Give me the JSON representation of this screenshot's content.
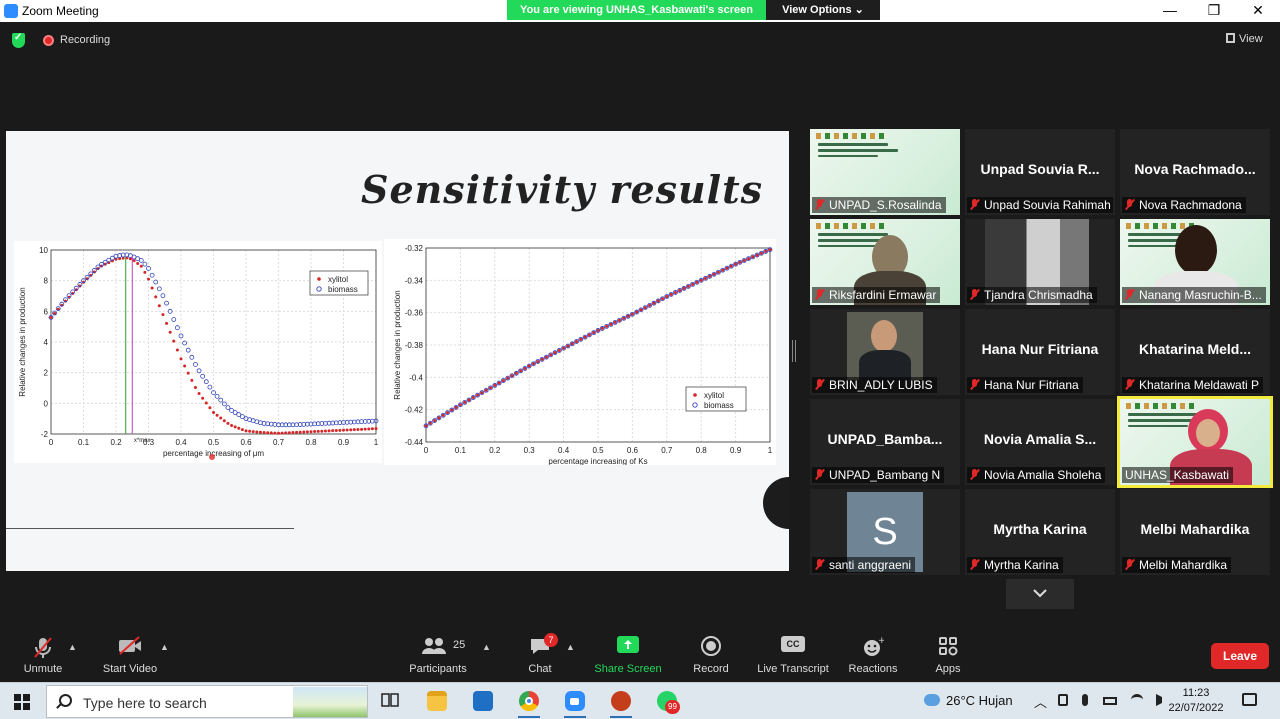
{
  "window": {
    "title": "Zoom Meeting",
    "banner": "You are viewing UNHAS_Kasbawati's screen",
    "view_options": "View Options",
    "minimize": "—",
    "maximize": "❐",
    "close": "✕"
  },
  "topbar": {
    "recording": "Recording",
    "view": "View"
  },
  "slide": {
    "title": "Sensitivity results",
    "left_chart": {
      "ylabel": "Relative changes in production",
      "xlabel": "percentage increasing of μm",
      "xticks": [
        "0",
        "0.1",
        "0.2",
        "0.3",
        "0.4",
        "0.5",
        "0.6",
        "0.7",
        "0.8",
        "0.9",
        "1"
      ],
      "yticks": [
        "10",
        "8",
        "6",
        "4",
        "2",
        "0",
        "-2"
      ],
      "legend": [
        "xylitol",
        "biomass"
      ],
      "max_label": "x*max"
    },
    "right_chart": {
      "ylabel": "Relative changes in production",
      "xlabel": "percentage increasing of Ks",
      "xticks": [
        "0",
        "0.1",
        "0.2",
        "0.3",
        "0.4",
        "0.5",
        "0.6",
        "0.7",
        "0.8",
        "0.9",
        "1"
      ],
      "yticks": [
        "-0.32",
        "-0.34",
        "-0.36",
        "-0.38",
        "-0.4",
        "-0.42",
        "-0.44"
      ],
      "legend": [
        "xylitol",
        "biomass"
      ]
    }
  },
  "chart_data": [
    {
      "type": "scatter",
      "xlabel": "percentage increasing of μm",
      "ylabel": "Relative changes in production",
      "xlim": [
        0,
        1
      ],
      "ylim": [
        -2,
        10
      ],
      "grid": true,
      "legend_position": "top-right",
      "series": [
        {
          "name": "xylitol",
          "color": "#d62728",
          "marker": "dot",
          "x": [
            0,
            0.05,
            0.1,
            0.15,
            0.2,
            0.23,
            0.25,
            0.28,
            0.3,
            0.35,
            0.4,
            0.45,
            0.5,
            0.55,
            0.6,
            0.65,
            0.7,
            0.75,
            0.8,
            0.85,
            0.9,
            0.95,
            1
          ],
          "y": [
            5.6,
            6.8,
            7.9,
            8.9,
            9.4,
            9.5,
            9.4,
            8.9,
            8.1,
            5.5,
            2.9,
            0.8,
            -0.6,
            -1.4,
            -1.8,
            -1.9,
            -1.95,
            -1.9,
            -1.85,
            -1.8,
            -1.75,
            -1.7,
            -1.65
          ]
        },
        {
          "name": "biomass",
          "color": "#3344bb",
          "marker": "circle",
          "x": [
            0,
            0.05,
            0.1,
            0.15,
            0.2,
            0.23,
            0.25,
            0.28,
            0.3,
            0.35,
            0.4,
            0.45,
            0.5,
            0.55,
            0.6,
            0.65,
            0.7,
            0.75,
            0.8,
            0.85,
            0.9,
            0.95,
            1
          ],
          "y": [
            5.6,
            6.9,
            8.0,
            9.0,
            9.6,
            9.7,
            9.6,
            9.3,
            8.8,
            6.8,
            4.4,
            2.3,
            0.7,
            -0.4,
            -1.0,
            -1.3,
            -1.4,
            -1.4,
            -1.35,
            -1.3,
            -1.25,
            -1.2,
            -1.15
          ]
        }
      ]
    },
    {
      "type": "scatter",
      "xlabel": "percentage increasing of Ks",
      "ylabel": "Relative changes in production",
      "xlim": [
        0,
        1
      ],
      "ylim": [
        -0.44,
        -0.32
      ],
      "grid": true,
      "legend_position": "bottom-right",
      "series": [
        {
          "name": "xylitol",
          "color": "#d62728",
          "marker": "dot",
          "x": [
            0,
            0.1,
            0.2,
            0.3,
            0.4,
            0.5,
            0.6,
            0.7,
            0.8,
            0.9,
            1
          ],
          "y": [
            -0.43,
            -0.417,
            -0.405,
            -0.393,
            -0.382,
            -0.371,
            -0.361,
            -0.35,
            -0.34,
            -0.33,
            -0.321
          ]
        },
        {
          "name": "biomass",
          "color": "#3344bb",
          "marker": "circle",
          "x": [
            0,
            0.1,
            0.2,
            0.3,
            0.4,
            0.5,
            0.6,
            0.7,
            0.8,
            0.9,
            1
          ],
          "y": [
            -0.43,
            -0.417,
            -0.405,
            -0.393,
            -0.382,
            -0.371,
            -0.361,
            -0.35,
            -0.34,
            -0.33,
            -0.321
          ]
        }
      ]
    }
  ],
  "gallery": [
    {
      "label": "UNPAD_S.Rosalinda",
      "name": "",
      "kind": "slide"
    },
    {
      "label": "Unpad Souvia Rahimah",
      "name": "Unpad Souvia R...",
      "kind": "name"
    },
    {
      "label": "Nova Rachmadona",
      "name": "Nova Rachmado...",
      "kind": "name"
    },
    {
      "label": "Riksfardini Ermawar",
      "name": "",
      "kind": "video-slide"
    },
    {
      "label": "Tjandra Chrismadha",
      "name": "",
      "kind": "video-room"
    },
    {
      "label": "Nanang Masruchin-B...",
      "name": "",
      "kind": "video-slide2"
    },
    {
      "label": "BRIN_ADLY LUBIS",
      "name": "",
      "kind": "photo"
    },
    {
      "label": "Hana Nur Fitriana",
      "name": "Hana Nur Fitriana",
      "kind": "name"
    },
    {
      "label": "Khatarina Meldawati P",
      "name": "Khatarina Meld...",
      "kind": "name"
    },
    {
      "label": "UNPAD_Bambang N",
      "name": "UNPAD_Bamba...",
      "kind": "name"
    },
    {
      "label": "Novia Amalia Sholeha",
      "name": "Novia Amalia S...",
      "kind": "name"
    },
    {
      "label": "UNHAS_Kasbawati",
      "name": "",
      "kind": "video-active"
    },
    {
      "label": "santi anggraeni",
      "name": "",
      "kind": "avatar",
      "initial": "S"
    },
    {
      "label": "Myrtha Karina",
      "name": "Myrtha Karina",
      "kind": "name"
    },
    {
      "label": "Melbi Mahardika",
      "name": "Melbi Mahardika",
      "kind": "name"
    }
  ],
  "toolbar": {
    "unmute": "Unmute",
    "start_video": "Start Video",
    "participants": "Participants",
    "participants_count": "25",
    "chat": "Chat",
    "chat_badge": "7",
    "share_screen": "Share Screen",
    "record": "Record",
    "live_transcript": "Live Transcript",
    "cc": "CC",
    "reactions": "Reactions",
    "apps": "Apps",
    "leave": "Leave"
  },
  "taskbar": {
    "search_placeholder": "Type here to search",
    "whatsapp_badge": "99",
    "weather": "26°C  Hujan",
    "time": "11:23",
    "date": "22/07/2022"
  },
  "colors": {
    "accent_green": "#23d959",
    "leave_red": "#e02828",
    "active_border": "#f2ea3c",
    "zoom_blue": "#2d8cff"
  }
}
